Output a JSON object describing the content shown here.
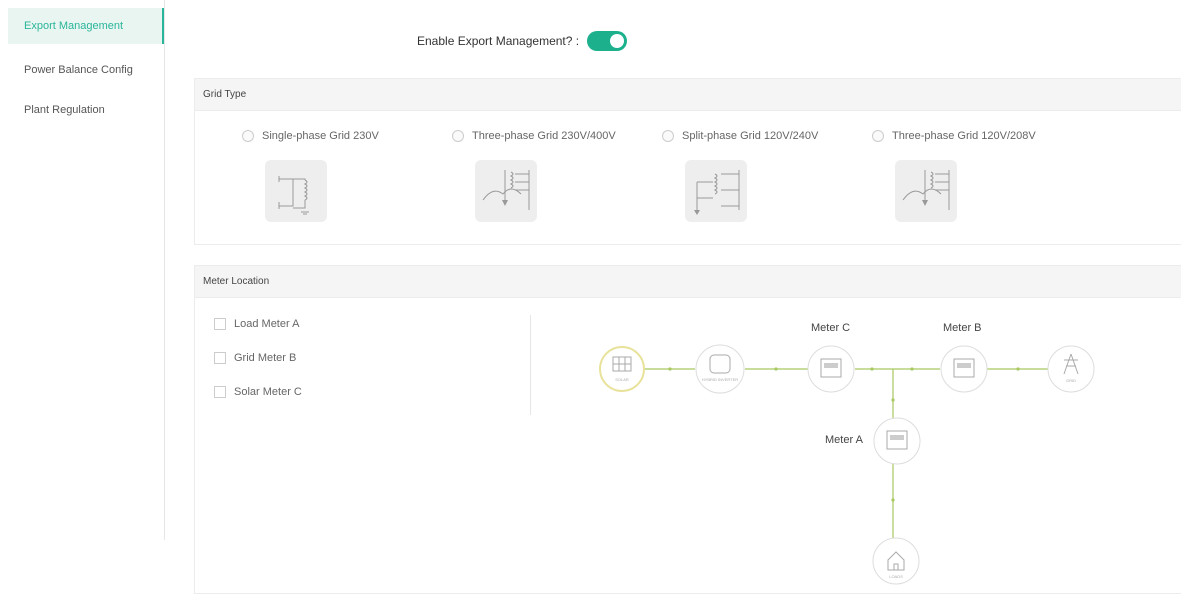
{
  "sidebar": {
    "items": [
      {
        "label": "Export Management",
        "active": true
      },
      {
        "label": "Power Balance Config",
        "active": false
      },
      {
        "label": "Plant Regulation",
        "active": false
      }
    ]
  },
  "enable_export": {
    "label": "Enable Export Management? :",
    "enabled": true
  },
  "grid_type": {
    "title": "Grid Type",
    "options": [
      {
        "label": "Single-phase Grid 230V"
      },
      {
        "label": "Three-phase Grid 230V/400V"
      },
      {
        "label": "Split-phase Grid 120V/240V"
      },
      {
        "label": "Three-phase Grid 120V/208V"
      }
    ]
  },
  "meter_location": {
    "title": "Meter Location",
    "checkboxes": [
      {
        "label": "Load Meter A",
        "checked": false
      },
      {
        "label": "Grid Meter B",
        "checked": false
      },
      {
        "label": "Solar Meter C",
        "checked": false
      }
    ],
    "diagram": {
      "meter_c_label": "Meter C",
      "meter_b_label": "Meter B",
      "meter_a_label": "Meter A",
      "solar_caption": "SOLAR",
      "inverter_caption": "HYBRID INVERTER",
      "grid_caption": "GRID",
      "load_caption": "LOADS"
    }
  },
  "colors": {
    "accent": "#1db08d",
    "line": "#a8c860",
    "solar_ring": "#e8e29a"
  }
}
